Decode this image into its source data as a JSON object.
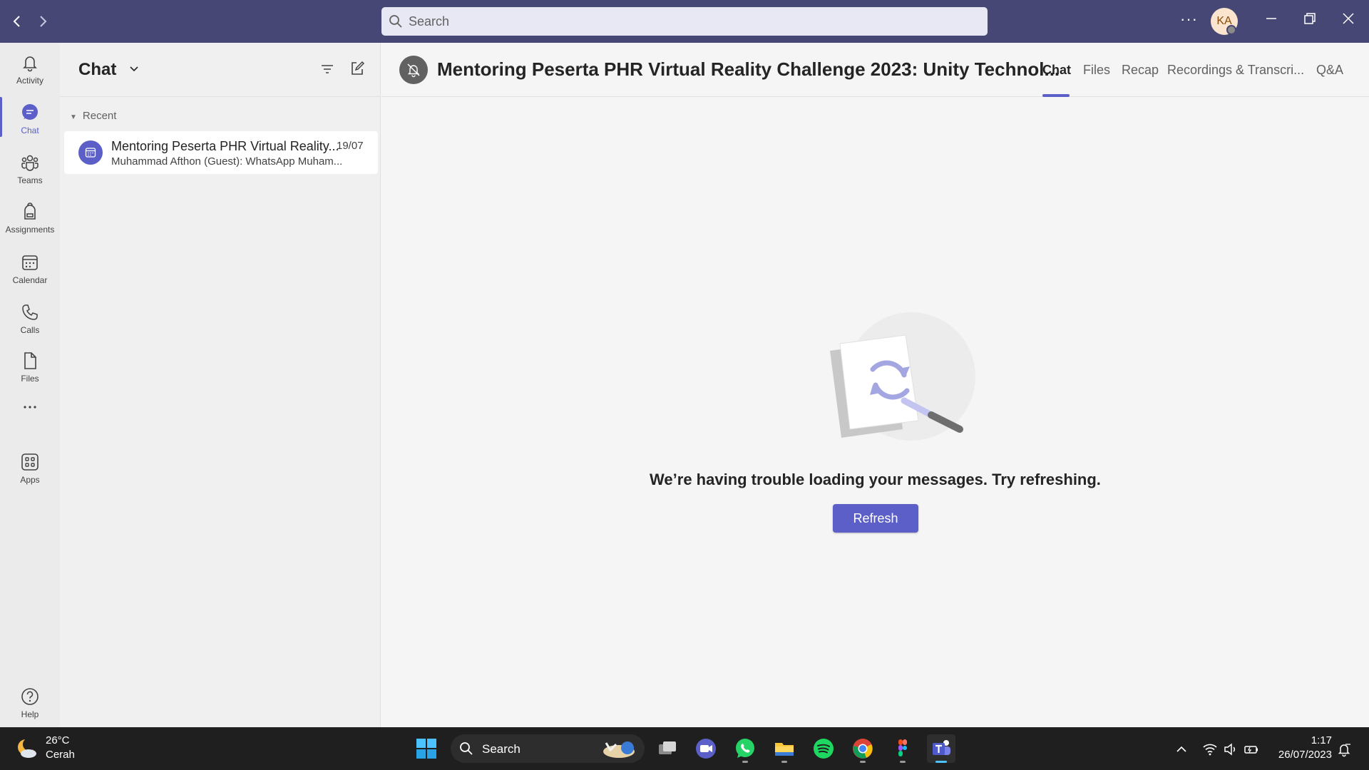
{
  "titlebar": {
    "search_placeholder": "Search",
    "avatar_initials": "KA"
  },
  "rail": {
    "items": [
      {
        "label": "Activity",
        "icon": "bell-icon"
      },
      {
        "label": "Chat",
        "icon": "chat-icon",
        "active": true
      },
      {
        "label": "Teams",
        "icon": "teams-icon"
      },
      {
        "label": "Assignments",
        "icon": "backpack-icon"
      },
      {
        "label": "Calendar",
        "icon": "calendar-icon"
      },
      {
        "label": "Calls",
        "icon": "phone-icon"
      },
      {
        "label": "Files",
        "icon": "file-icon"
      },
      {
        "label": "Apps",
        "icon": "apps-icon"
      },
      {
        "label": "Help",
        "icon": "help-icon"
      }
    ]
  },
  "chatpane": {
    "title": "Chat",
    "section_label": "Recent",
    "items": [
      {
        "title": "Mentoring Peserta PHR Virtual Reality...",
        "date": "19/07",
        "preview": "Muhammad Afthon (Guest): WhatsApp Muham..."
      }
    ]
  },
  "main": {
    "title": "Mentoring Peserta PHR Virtual Reality Challenge 2023: Unity Technol...",
    "tabs": [
      {
        "label": "Chat",
        "active": true
      },
      {
        "label": "Files"
      },
      {
        "label": "Recap"
      },
      {
        "label": "Recordings & Transcri..."
      },
      {
        "label": "Q&A"
      }
    ],
    "error_message": "We’re having trouble loading your messages. Try refreshing.",
    "refresh_label": "Refresh"
  },
  "taskbar": {
    "weather_temp": "26°C",
    "weather_condition": "Cerah",
    "search_label": "Search",
    "time": "1:17",
    "date": "26/07/2023"
  },
  "colors": {
    "titlebar": "#464775",
    "accent": "#5b5fc7",
    "taskbar": "#1f1f1f"
  }
}
